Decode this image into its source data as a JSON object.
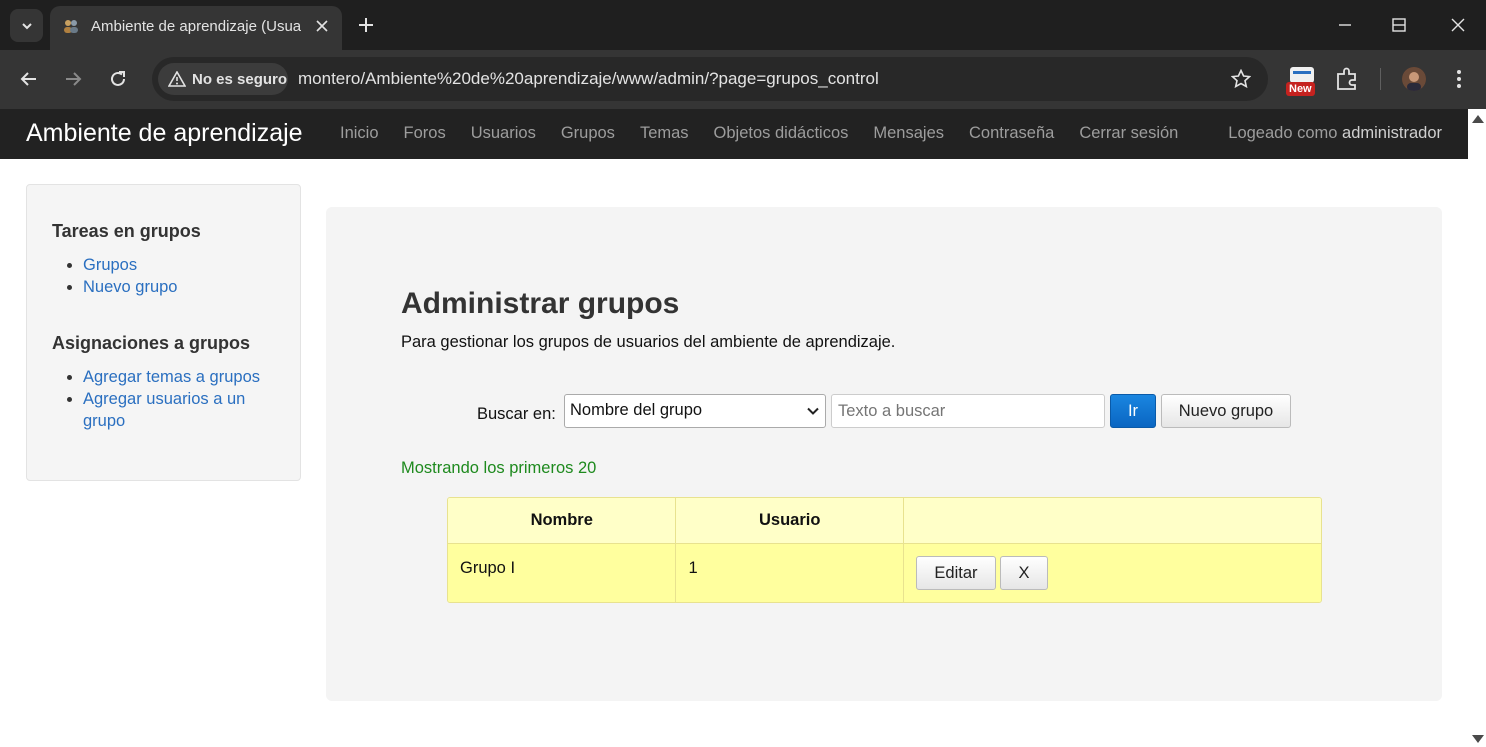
{
  "browser": {
    "tab_title": "Ambiente de aprendizaje (Usua",
    "security_label": "No es seguro",
    "url": "montero/Ambiente%20de%20aprendizaje/www/admin/?page=grupos_control",
    "new_badge": "New"
  },
  "navbar": {
    "brand": "Ambiente de aprendizaje",
    "links": [
      "Inicio",
      "Foros",
      "Usuarios",
      "Grupos",
      "Temas",
      "Objetos didácticos",
      "Mensajes",
      "Contraseña",
      "Cerrar sesión"
    ],
    "logged_prefix": "Logeado como",
    "logged_user": "administrador"
  },
  "sidebar": {
    "section1_title": "Tareas en grupos",
    "section1_items": [
      "Grupos",
      "Nuevo grupo"
    ],
    "section2_title": "Asignaciones a grupos",
    "section2_items": [
      "Agregar temas a grupos",
      "Agregar usuarios a un grupo"
    ]
  },
  "main": {
    "title": "Administrar grupos",
    "subtitle": "Para gestionar los grupos de usuarios del ambiente de aprendizaje.",
    "search_label": "Buscar en:",
    "search_field_selected": "Nombre del grupo",
    "search_placeholder": "Texto a buscar",
    "go_label": "Ir",
    "new_group_label": "Nuevo grupo",
    "showing_text": "Mostrando los primeros 20"
  },
  "table": {
    "headers": [
      "Nombre",
      "Usuario",
      ""
    ],
    "rows": [
      {
        "name": "Grupo I",
        "user": "1",
        "edit_label": "Editar",
        "delete_label": "X"
      }
    ]
  }
}
